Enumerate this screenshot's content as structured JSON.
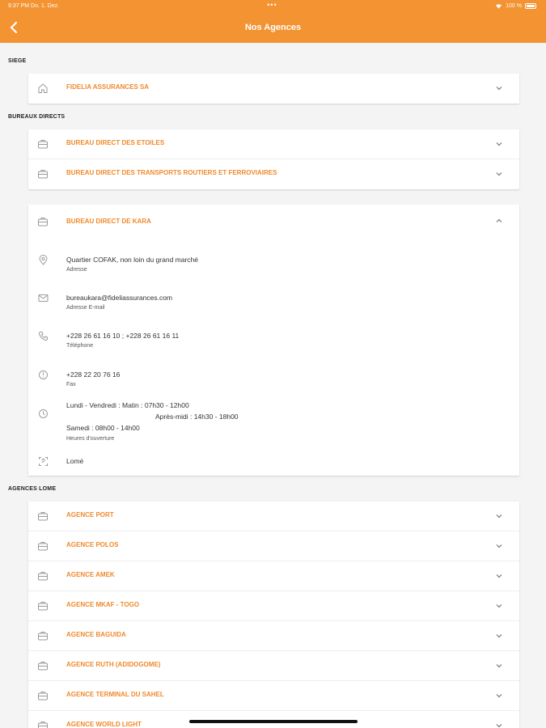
{
  "status_bar": {
    "time": "9:37 PM  Do. 1. Dez.",
    "dots": "•••",
    "battery_text": "100 %"
  },
  "header": {
    "title": "Nos Agences"
  },
  "sections": {
    "siege": "SIEGE",
    "bureaux": "BUREAUX DIRECTS",
    "agences": "AGENCES LOME"
  },
  "siege_items": [
    {
      "label": "FIDELIA ASSURANCES SA"
    }
  ],
  "bureaux_items": [
    {
      "label": "BUREAU DIRECT DES ETOILES"
    },
    {
      "label": "BUREAU DIRECT DES TRANSPORTS ROUTIERS ET FERROVIAIRES"
    }
  ],
  "kara": {
    "label": "BUREAU DIRECT DE KARA",
    "address": "Quartier COFAK, non loin du grand marché",
    "address_label": "Adresse",
    "email": "bureaukara@fideliassurances.com",
    "email_label": "Adresse E-mail",
    "phone": "+228 26 61 16 10 ; +228 26 61 16 11",
    "phone_label": "Téléphone",
    "fax": "+228 22 20 76 16",
    "fax_label": "Fax",
    "hours_line1": "Lundi - Vendredi : Matin : 07h30 - 12h00",
    "hours_line2": "Après-midi : 14h30 - 18h00",
    "hours_line3": "Samedi : 08h00 - 14h00",
    "hours_label": "Heures d'ouverture",
    "city": "Lomé"
  },
  "agences_items": [
    {
      "label": "AGENCE PORT"
    },
    {
      "label": "AGENCE POLOS"
    },
    {
      "label": "AGENCE AMEK"
    },
    {
      "label": "AGENCE MKAF - TOGO"
    },
    {
      "label": "AGENCE BAGUIDA"
    },
    {
      "label": "AGENCE RUTH (ADIDOGOME)"
    },
    {
      "label": "AGENCE TERMINAL DU SAHEL"
    },
    {
      "label": "AGENCE WORLD LIGHT"
    }
  ],
  "colors": {
    "accent": "#f39332",
    "label_orange": "#f0892b",
    "icon_gray": "#9a9a9a"
  }
}
